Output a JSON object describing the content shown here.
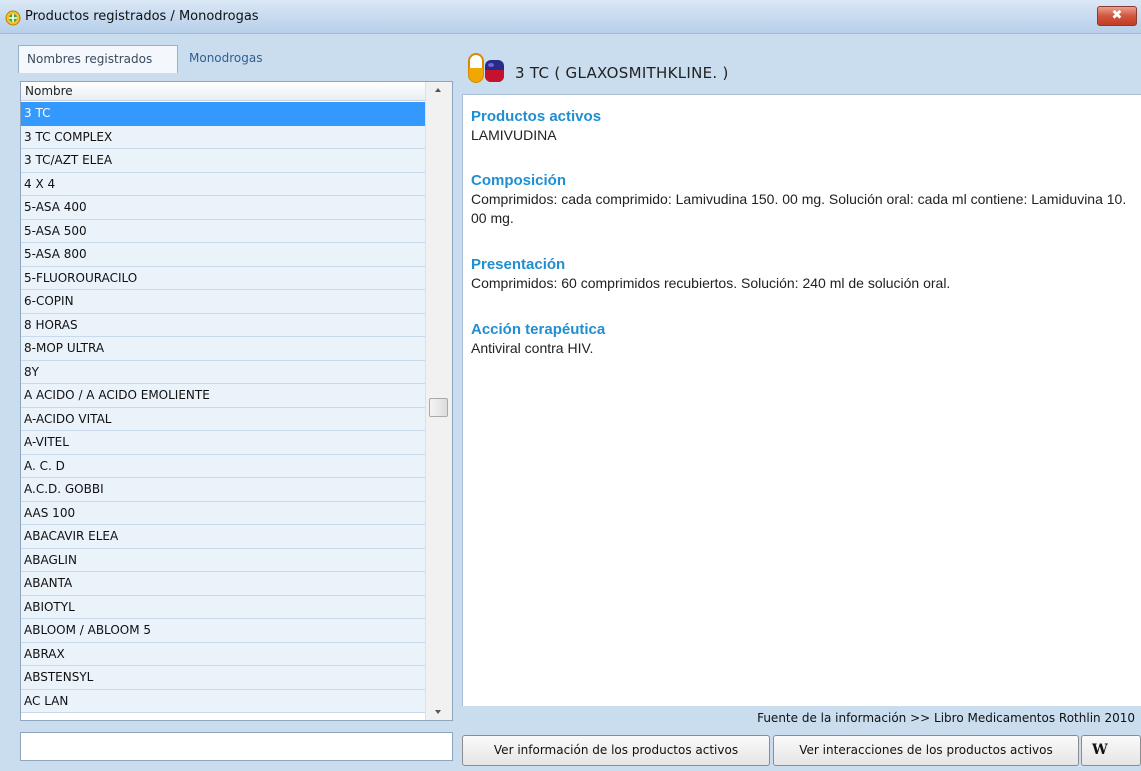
{
  "window": {
    "title": "Productos registrados / Monodrogas",
    "close_glyph": "✖"
  },
  "tabs": [
    {
      "label": "Nombres registrados",
      "active": true
    },
    {
      "label": "Monodrogas",
      "active": false
    }
  ],
  "list": {
    "column_header": "Nombre",
    "selected_index": 0,
    "items": [
      "3 TC",
      "3 TC COMPLEX",
      "3 TC/AZT ELEA",
      "4 X 4",
      "5-ASA 400",
      "5-ASA 500",
      "5-ASA 800",
      "5-FLUOROURACILO",
      "6-COPIN",
      "8 HORAS",
      "8-MOP ULTRA",
      "8Y",
      "A ACIDO / A ACIDO EMOLIENTE",
      "A-ACIDO VITAL",
      "A-VITEL",
      "A. C. D",
      "A.C.D. GOBBI",
      "AAS 100",
      "ABACAVIR ELEA",
      "ABAGLIN",
      "ABANTA",
      "ABIOTYL",
      "ABLOOM / ABLOOM 5",
      "ABRAX",
      "ABSTENSYL",
      "AC LAN"
    ],
    "filter_value": ""
  },
  "product": {
    "title": "3 TC ( GLAXOSMITHKLINE. )",
    "sections": [
      {
        "heading": "Productos activos",
        "text": "LAMIVUDINA"
      },
      {
        "heading": "Composición",
        "text": "Comprimidos: cada comprimido: Lamivudina 150. 00 mg. Solución oral: cada ml contiene: Lamiduvina 10. 00 mg."
      },
      {
        "heading": "Presentación",
        "text": "Comprimidos:  60 comprimidos recubiertos. Solución:  240 ml de solución oral."
      },
      {
        "heading": "Acción terapéutica",
        "text": "Antiviral contra HIV."
      }
    ]
  },
  "footer": {
    "source": "Fuente de la información >> Libro Medicamentos Rothlin 2010",
    "btn_active": "Ver información de los productos activos",
    "btn_interactions": "Ver interacciones de los productos activos",
    "btn_w": "W"
  },
  "colors": {
    "accent_heading": "#1f8fd1",
    "selection": "#3399ff",
    "row_bg": "#eaf2fa"
  }
}
